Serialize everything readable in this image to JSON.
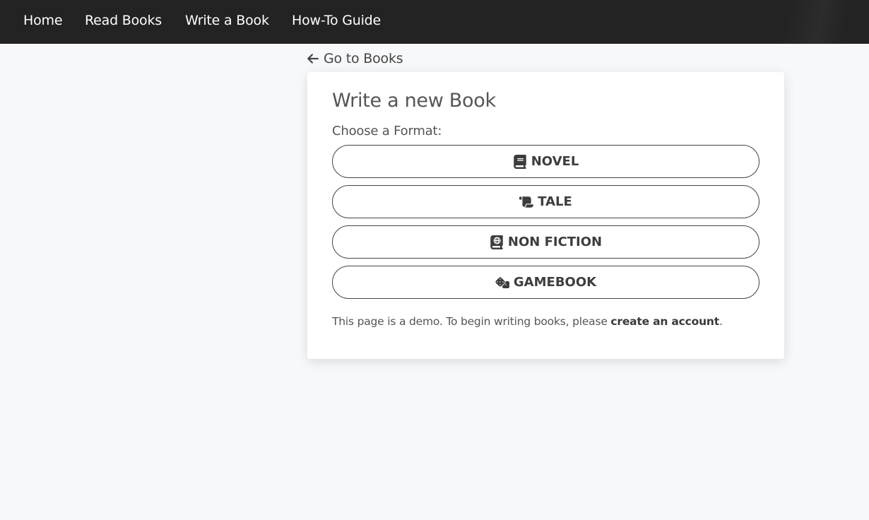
{
  "nav": {
    "items": [
      {
        "label": "Home"
      },
      {
        "label": "Read Books"
      },
      {
        "label": "Write a Book"
      },
      {
        "label": "How-To Guide"
      }
    ]
  },
  "back_link": {
    "label": "Go to Books",
    "icon": "arrow-left-icon"
  },
  "card": {
    "title": "Write a new Book",
    "format_label": "Choose a Format:",
    "formats": [
      {
        "label": "NOVEL",
        "icon": "book-icon"
      },
      {
        "label": "TALE",
        "icon": "scroll-icon"
      },
      {
        "label": "NON FICTION",
        "icon": "atlas-icon"
      },
      {
        "label": "GAMEBOOK",
        "icon": "dice-icon"
      }
    ],
    "demo_text_before": "This page is a demo. To begin writing books, please ",
    "demo_link": "create an account",
    "demo_text_after": "."
  },
  "colors": {
    "navbar_bg": "#232323",
    "page_bg": "#f7f8fa",
    "text": "#3d3d3d"
  }
}
